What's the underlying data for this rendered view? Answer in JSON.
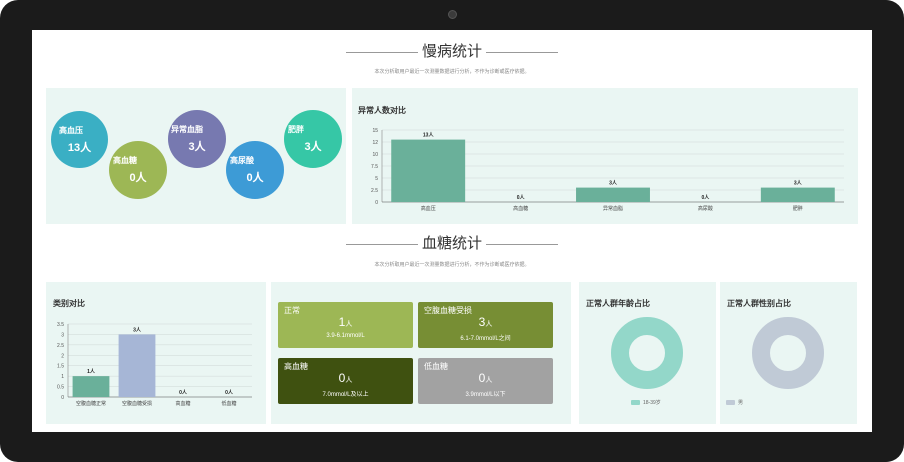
{
  "section1": {
    "title": "慢病统计",
    "subtitle": "本次分析取用户最近一次测量数据进行分析，不作为诊断或医疗依据。"
  },
  "bubbles": [
    {
      "label": "高血压",
      "value": "13人",
      "color": "#3aafc4"
    },
    {
      "label": "高血糖",
      "value": "0人",
      "color": "#9db755"
    },
    {
      "label": "异常血脂",
      "value": "3人",
      "color": "#7779b0"
    },
    {
      "label": "高尿酸",
      "value": "0人",
      "color": "#3d9bd6"
    },
    {
      "label": "肥胖",
      "value": "3人",
      "color": "#36c7a6"
    }
  ],
  "abnormal_panel": {
    "title": "异常人数对比"
  },
  "section2": {
    "title": "血糖统计",
    "subtitle": "本次分析取用户最近一次测量数据进行分析，不作为诊断或医疗依据。"
  },
  "category_panel": {
    "title": "类别对比"
  },
  "glucose_cards": [
    {
      "title": "正常",
      "value": "1",
      "unit": "人",
      "range": "3.9-6.1mmol/L",
      "color": "#9db755"
    },
    {
      "title": "空腹血糖受损",
      "value": "3",
      "unit": "人",
      "range": "6.1-7.0mmol/L之间",
      "color": "#778e34"
    },
    {
      "title": "高血糖",
      "value": "0",
      "unit": "人",
      "range": "7.0mmol/L及以上",
      "color": "#3f5110"
    },
    {
      "title": "低血糖",
      "value": "0",
      "unit": "人",
      "range": "3.9mmol/L以下",
      "color": "#a2a2a2"
    }
  ],
  "age_panel": {
    "title": "正常人群年龄占比",
    "legend": "18-39岁",
    "color": "#93d7c9"
  },
  "gender_panel": {
    "title": "正常人群性别占比",
    "legend": "男",
    "color": "#c0cad6"
  },
  "chart_data": [
    {
      "type": "bar",
      "title": "异常人数对比",
      "categories": [
        "高血压",
        "高血糖",
        "异常血脂",
        "高尿酸",
        "肥胖"
      ],
      "values": [
        13,
        0,
        3,
        0,
        3
      ],
      "data_labels": [
        "13人",
        "0人",
        "3人",
        "0人",
        "3人"
      ],
      "yticks": [
        "0",
        "2.5",
        "5",
        "7.5",
        "10",
        "12",
        "15"
      ],
      "ylim": [
        0,
        15
      ],
      "color": "#6ab09a",
      "grid": true
    },
    {
      "type": "bar",
      "title": "类别对比",
      "categories": [
        "空腹血糖正常",
        "空腹血糖受损",
        "高血糖",
        "低血糖"
      ],
      "values": [
        1,
        3,
        0,
        0
      ],
      "data_labels": [
        "1人",
        "3人",
        "0人",
        "0人"
      ],
      "yticks": [
        "0",
        "0.5",
        "1",
        "1.5",
        "2",
        "2.5",
        "3",
        "3.5"
      ],
      "ylim": [
        0,
        3.5
      ],
      "colors": [
        "#6ab09a",
        "#a6b6d6",
        "#6ab09a",
        "#6ab09a"
      ],
      "grid": true
    },
    {
      "type": "pie",
      "title": "正常人群年龄占比",
      "labels": [
        "18-39岁"
      ],
      "values": [
        1
      ],
      "color": "#93d7c9"
    },
    {
      "type": "pie",
      "title": "正常人群性别占比",
      "labels": [
        "男"
      ],
      "values": [
        1
      ],
      "color": "#c0cad6"
    }
  ]
}
